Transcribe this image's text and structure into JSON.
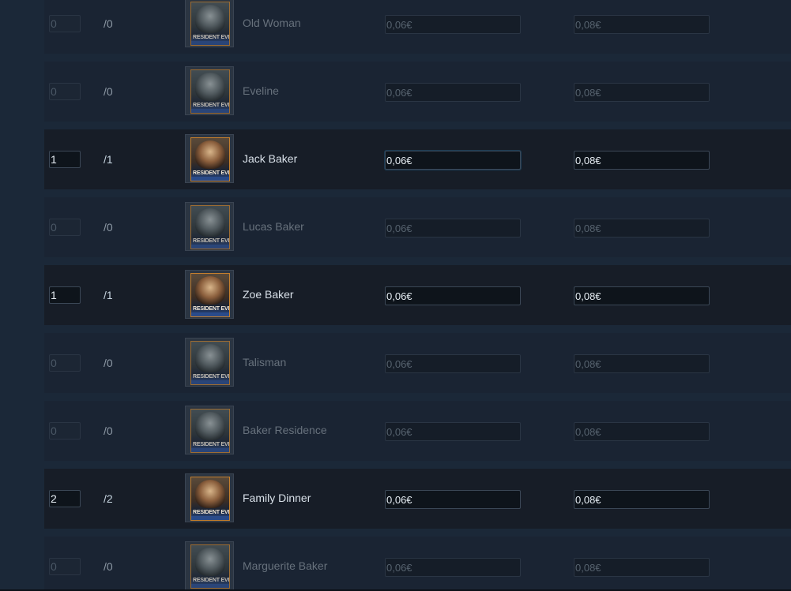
{
  "rows": [
    {
      "qty": "0",
      "max": "/0",
      "name": "Old Woman",
      "buy_price": "0,06€",
      "sell_price": "0,08€",
      "state": "dim",
      "card_logo": "RESIDENT EVIL"
    },
    {
      "qty": "0",
      "max": "/0",
      "name": "Eveline",
      "buy_price": "0,06€",
      "sell_price": "0,08€",
      "state": "dim",
      "card_logo": "RESIDENT EVIL"
    },
    {
      "qty": "1",
      "max": "/1",
      "name": "Jack Baker",
      "buy_price": "0,06€",
      "sell_price": "0,08€",
      "state": "active",
      "card_logo": "RESIDENT EVIL",
      "focused_field": "buy"
    },
    {
      "qty": "0",
      "max": "/0",
      "name": "Lucas Baker",
      "buy_price": "0,06€",
      "sell_price": "0,08€",
      "state": "dim",
      "card_logo": "RESIDENT EVIL"
    },
    {
      "qty": "1",
      "max": "/1",
      "name": "Zoe Baker",
      "buy_price": "0,06€",
      "sell_price": "0,08€",
      "state": "active",
      "card_logo": "RESIDENT EVIL"
    },
    {
      "qty": "0",
      "max": "/0",
      "name": "Talisman",
      "buy_price": "0,06€",
      "sell_price": "0,08€",
      "state": "dim",
      "card_logo": "RESIDENT EVIL"
    },
    {
      "qty": "0",
      "max": "/0",
      "name": "Baker Residence",
      "buy_price": "0,06€",
      "sell_price": "0,08€",
      "state": "dim",
      "card_logo": "RESIDENT EVIL"
    },
    {
      "qty": "2",
      "max": "/2",
      "name": "Family Dinner",
      "buy_price": "0,06€",
      "sell_price": "0,08€",
      "state": "active",
      "card_logo": "RESIDENT EVIL"
    },
    {
      "qty": "0",
      "max": "/0",
      "name": "Marguerite Baker",
      "buy_price": "0,06€",
      "sell_price": "0,08€",
      "state": "dim",
      "card_logo": "RESIDENT EVIL"
    }
  ],
  "colors": {
    "page_bg": "#1b2838",
    "focus_border": "#66b2e4",
    "card_border": "#c47f2d"
  },
  "icons": {
    "card_thumbnail": "trading-card-icon"
  }
}
